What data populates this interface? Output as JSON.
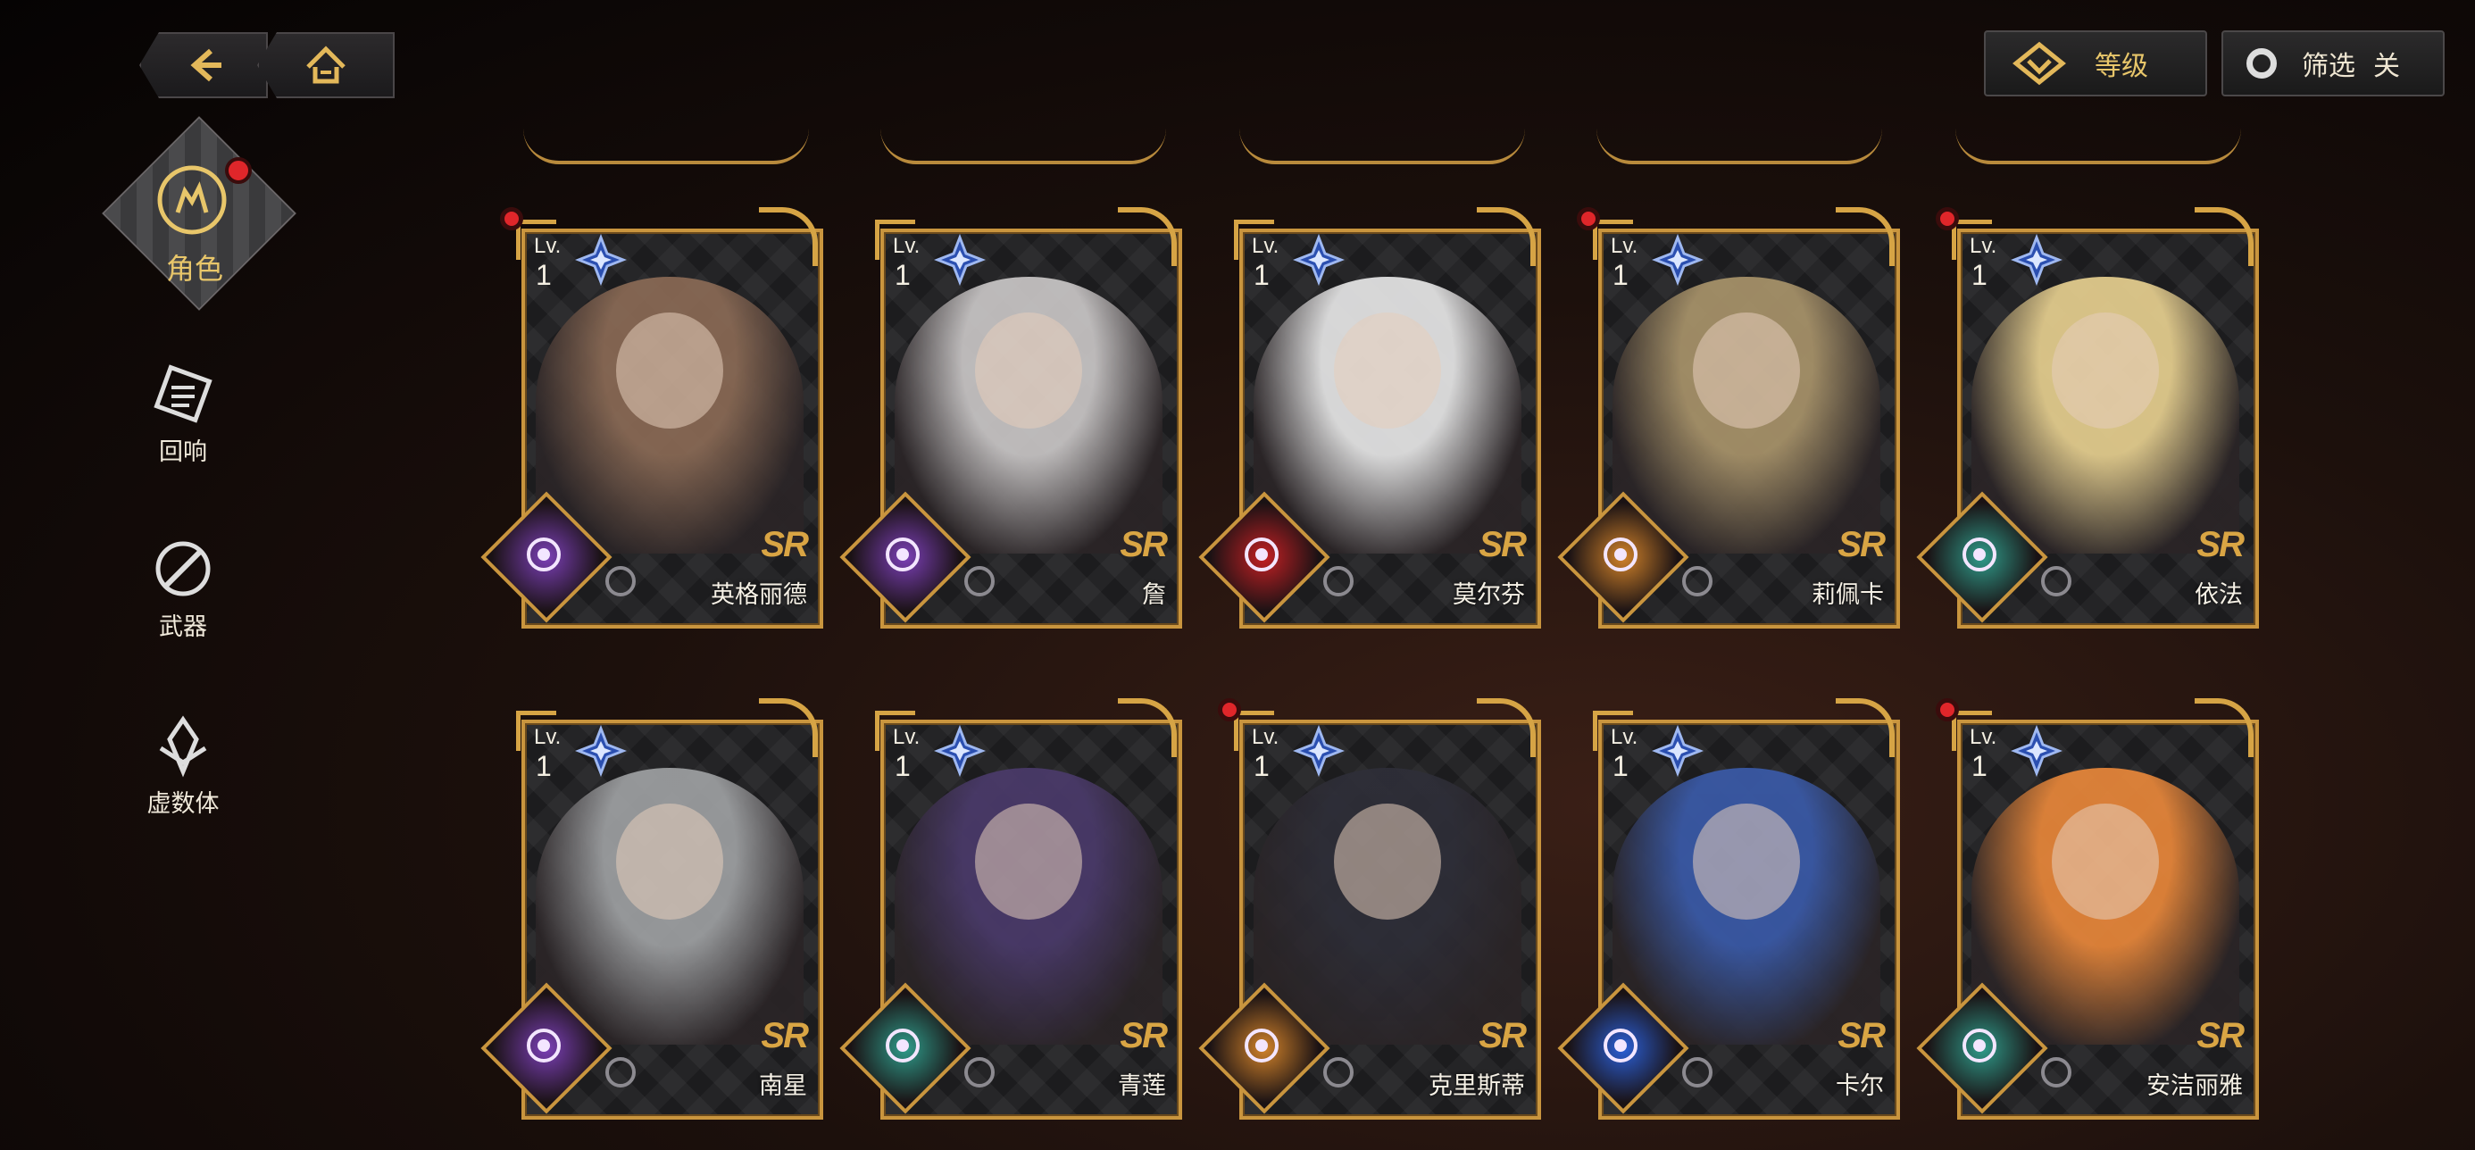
{
  "nav": {
    "back_icon": "back-arrow-icon",
    "home_icon": "home-icon"
  },
  "top_controls": {
    "sort_label": "等级",
    "filter_label": "筛选",
    "filter_state": "关"
  },
  "sidebar": {
    "items": [
      {
        "label": "角色",
        "icon": "character-icon",
        "active": true,
        "badge": true
      },
      {
        "label": "回响",
        "icon": "echo-icon",
        "active": false
      },
      {
        "label": "武器",
        "icon": "weapon-icon",
        "active": false
      },
      {
        "label": "虚数体",
        "icon": "imaginary-icon",
        "active": false
      }
    ]
  },
  "colors": {
    "gold": "#c9953e",
    "accent_text": "#e8c66a",
    "badge_red": "#e0262a",
    "element_purple": "#7b3fb6",
    "element_red": "#c32024",
    "element_orange": "#d1822a",
    "element_teal": "#2f9b8a",
    "element_blue": "#2b5fd6"
  },
  "cards": [
    {
      "level_label": "Lv.",
      "level": "1",
      "rarity": "SR",
      "name": "英格丽德",
      "element": "purple",
      "badge": true,
      "hair": "#8a6a55"
    },
    {
      "level_label": "Lv.",
      "level": "1",
      "rarity": "SR",
      "name": "詹",
      "element": "purple",
      "badge": false,
      "hair": "#c9c6c6"
    },
    {
      "level_label": "Lv.",
      "level": "1",
      "rarity": "SR",
      "name": "莫尔芬",
      "element": "red",
      "badge": false,
      "hair": "#e6e6e6"
    },
    {
      "level_label": "Lv.",
      "level": "1",
      "rarity": "SR",
      "name": "莉佩卡",
      "element": "orange",
      "badge": true,
      "hair": "#a8936a"
    },
    {
      "level_label": "Lv.",
      "level": "1",
      "rarity": "SR",
      "name": "依法",
      "element": "teal",
      "badge": true,
      "hair": "#e6cf8f"
    },
    {
      "level_label": "Lv.",
      "level": "1",
      "rarity": "SR",
      "name": "南星",
      "element": "purple",
      "badge": false,
      "hair": "#9ea0a2"
    },
    {
      "level_label": "Lv.",
      "level": "1",
      "rarity": "SR",
      "name": "青莲",
      "element": "teal",
      "badge": false,
      "hair": "#4a3a6a"
    },
    {
      "level_label": "Lv.",
      "level": "1",
      "rarity": "SR",
      "name": "克里斯蒂",
      "element": "orange",
      "badge": true,
      "hair": "#2e2e38"
    },
    {
      "level_label": "Lv.",
      "level": "1",
      "rarity": "SR",
      "name": "卡尔",
      "element": "blue",
      "badge": false,
      "hair": "#3a5aa8"
    },
    {
      "level_label": "Lv.",
      "level": "1",
      "rarity": "SR",
      "name": "安洁丽雅",
      "element": "teal",
      "badge": true,
      "hair": "#e8873a"
    }
  ]
}
